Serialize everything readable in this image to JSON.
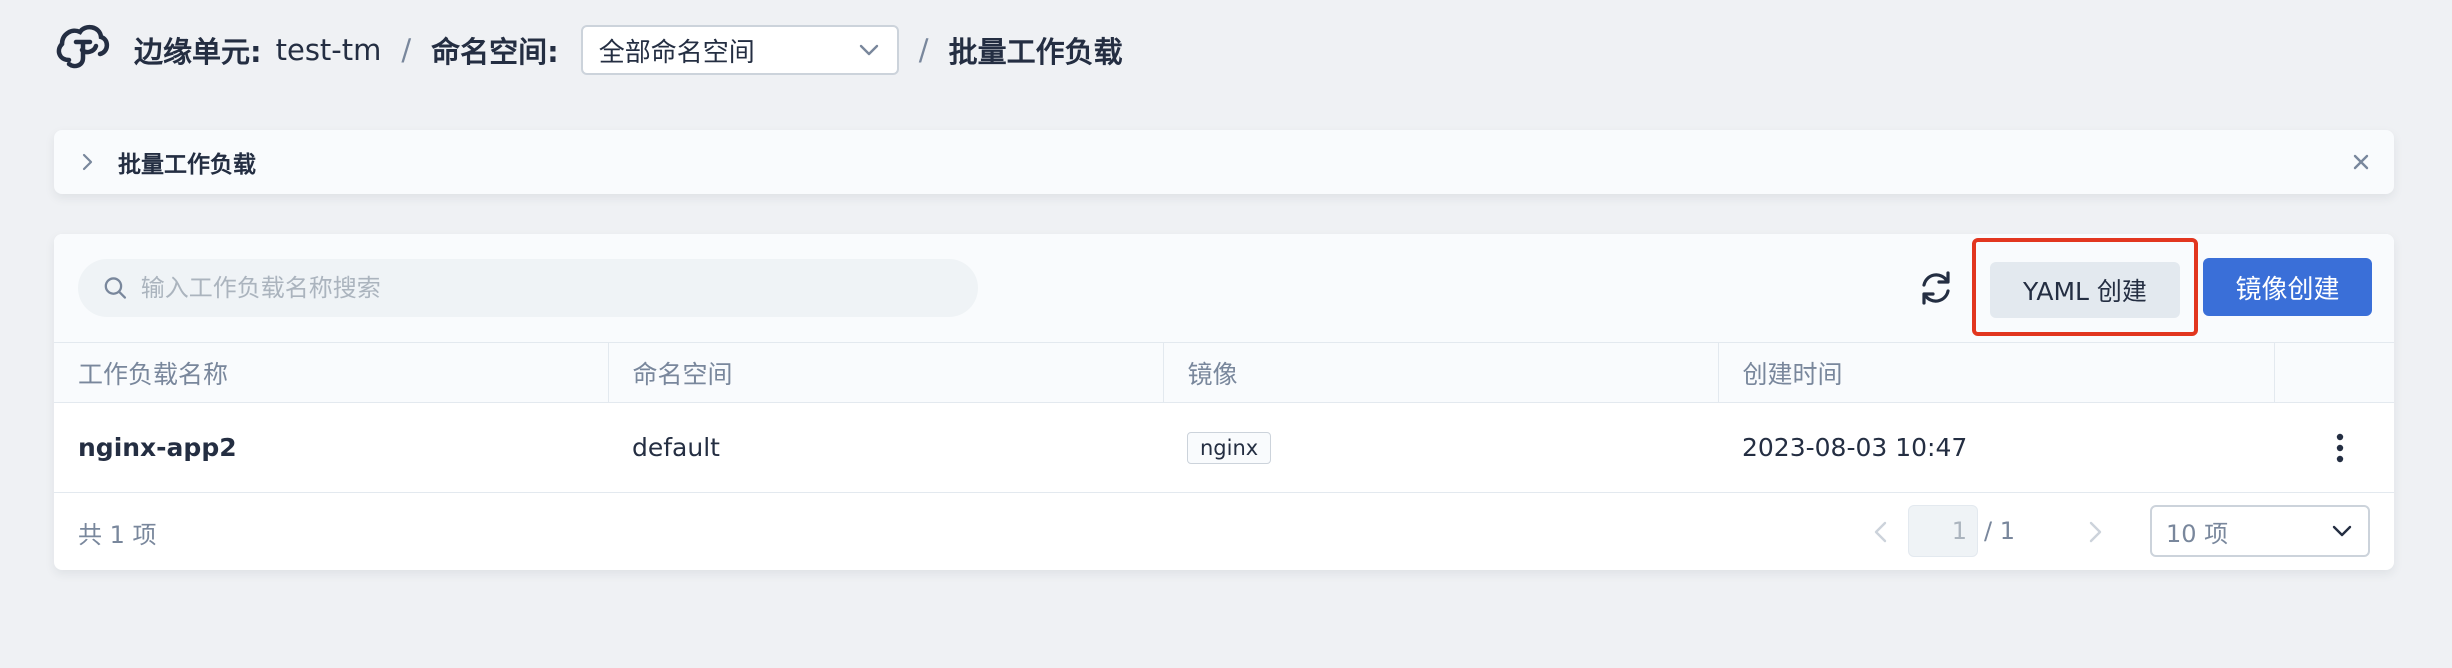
{
  "header": {
    "edge_unit_label": "边缘单元:",
    "edge_unit_value": "test-tm",
    "separator": "/",
    "namespace_label": "命名空间:",
    "namespace_selected": "全部命名空间",
    "page_title": "批量工作负载"
  },
  "banner": {
    "title": "批量工作负载"
  },
  "toolbar": {
    "search_placeholder": "输入工作负载名称搜索",
    "yaml_create_label": "YAML 创建",
    "image_create_label": "镜像创建"
  },
  "table": {
    "columns": [
      "工作负载名称",
      "命名空间",
      "镜像",
      "创建时间"
    ],
    "rows": [
      {
        "name": "nginx-app2",
        "namespace": "default",
        "image": "nginx",
        "created": "2023-08-03 10:47"
      }
    ]
  },
  "footer": {
    "total_text": "共 1 项",
    "page_current": "1",
    "page_total": "/ 1",
    "page_size": "10 项"
  },
  "colors": {
    "primary": "#3a6fd8",
    "highlight_box": "#e2361f",
    "text": "#242e42",
    "muted": "#79879c"
  }
}
